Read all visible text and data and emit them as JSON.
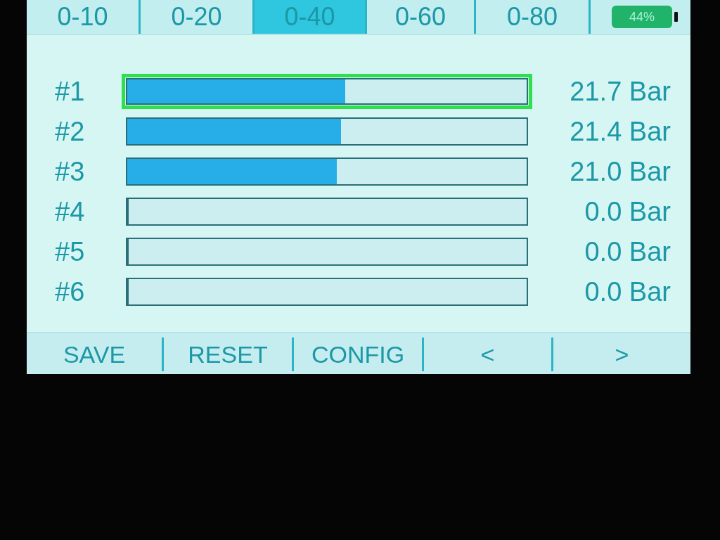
{
  "tabs": [
    {
      "label": "0-10",
      "selected": false
    },
    {
      "label": "0-20",
      "selected": false
    },
    {
      "label": "0-40",
      "selected": true
    },
    {
      "label": "0-60",
      "selected": false
    },
    {
      "label": "0-80",
      "selected": false
    }
  ],
  "battery": {
    "text": "44%"
  },
  "channels": [
    {
      "label": "#1",
      "selected": true,
      "level": 0.545,
      "reading": "21.7 Bar"
    },
    {
      "label": "#2",
      "selected": false,
      "level": 0.535,
      "reading": "21.4 Bar"
    },
    {
      "label": "#3",
      "selected": false,
      "level": 0.525,
      "reading": "21.0 Bar"
    },
    {
      "label": "#4",
      "selected": false,
      "level": 0,
      "reading": "0.0 Bar"
    },
    {
      "label": "#5",
      "selected": false,
      "level": 0,
      "reading": "0.0 Bar"
    },
    {
      "label": "#6",
      "selected": false,
      "level": 0,
      "reading": "0.0 Bar"
    }
  ],
  "buttons": [
    "SAVE",
    "RESET",
    "CONFIG",
    "<",
    ">"
  ]
}
